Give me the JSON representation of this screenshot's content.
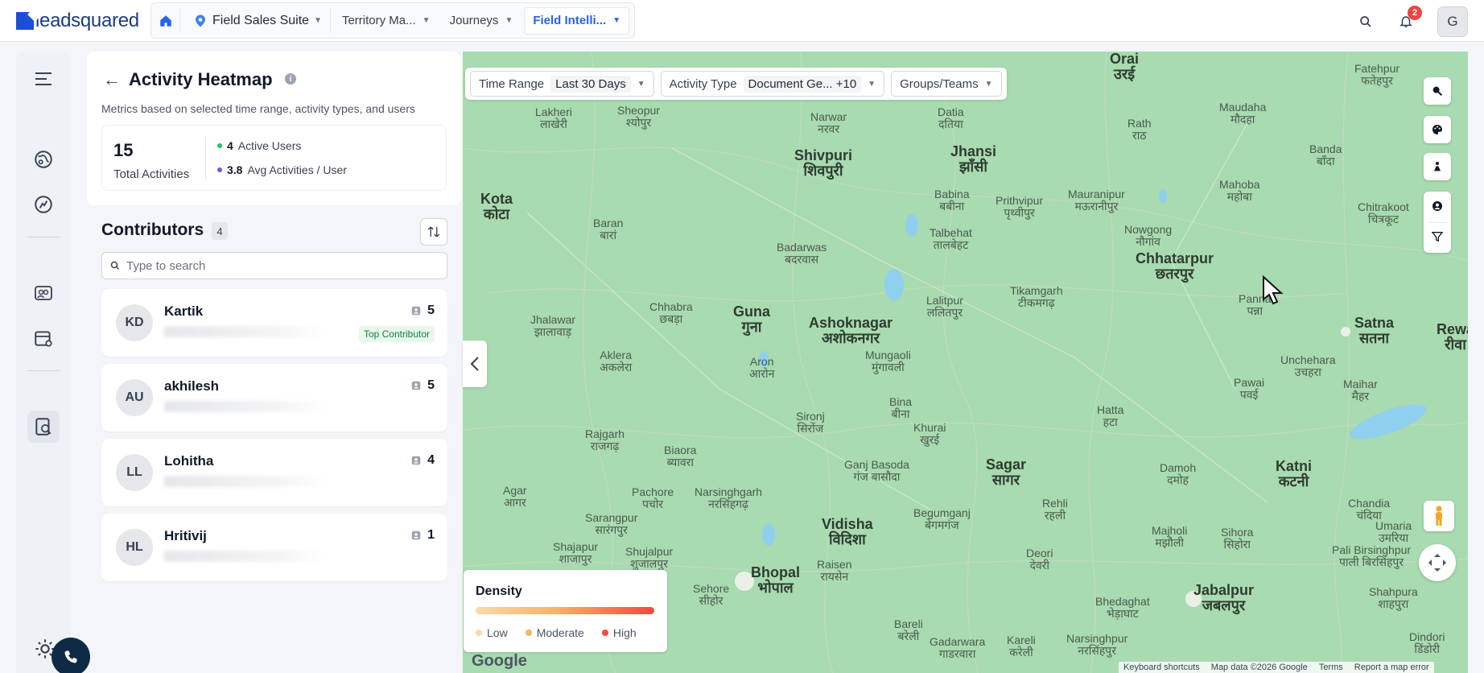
{
  "brand": {
    "name": "leadsquared"
  },
  "nav": {
    "suite": "Field Sales Suite",
    "tabs": [
      {
        "label": "Territory Ma..."
      },
      {
        "label": "Journeys"
      },
      {
        "label": "Field Intelli..."
      }
    ]
  },
  "header": {
    "notifications_count": "2",
    "user_initial": "G"
  },
  "panel": {
    "title": "Activity Heatmap",
    "subtitle": "Metrics based on selected time range, activity types, and users",
    "total_activities": "15",
    "total_activities_label": "Total Activities",
    "active_users_value": "4",
    "active_users_label": "Active Users",
    "avg_value": "3.8",
    "avg_label": "Avg Activities / User"
  },
  "contributors": {
    "title": "Contributors",
    "count": "4",
    "search_placeholder": "Type to search",
    "items": [
      {
        "initials": "KD",
        "name": "Kartik",
        "count": "5",
        "badge": "Top Contributor"
      },
      {
        "initials": "AU",
        "name": "akhilesh",
        "count": "5"
      },
      {
        "initials": "LL",
        "name": "Lohitha",
        "count": "4"
      },
      {
        "initials": "HL",
        "name": "Hritivij",
        "count": "1"
      }
    ]
  },
  "filters": {
    "time_range_label": "Time Range",
    "time_range_value": "Last 30 Days",
    "activity_type_label": "Activity Type",
    "activity_type_value": "Document Ge... +10",
    "groups_label": "Groups/Teams"
  },
  "legend": {
    "title": "Density",
    "low": "Low",
    "moderate": "Moderate",
    "high": "High",
    "colors": {
      "low": "#fcd9a8",
      "moderate": "#f7b264",
      "high": "#ef4b3c"
    }
  },
  "map": {
    "cities": [
      {
        "name": "Shivpuri",
        "native": "शिवपुरी",
        "size": "big"
      },
      {
        "name": "Jhansi",
        "native": "झाँसी",
        "size": "big"
      },
      {
        "name": "Kota",
        "native": "कोटा",
        "size": "big"
      },
      {
        "name": "Chhatarpur",
        "native": "छतरपुर",
        "size": "big"
      },
      {
        "name": "Guna",
        "native": "गुना",
        "size": "big"
      },
      {
        "name": "Ashoknagar",
        "native": "अशोकनगर",
        "size": "big"
      },
      {
        "name": "Satna",
        "native": "सतना",
        "size": "big"
      },
      {
        "name": "Rewa",
        "native": "रीवा",
        "size": "big"
      },
      {
        "name": "Sagar",
        "native": "सागर",
        "size": "big"
      },
      {
        "name": "Katni",
        "native": "कटनी",
        "size": "big"
      },
      {
        "name": "Vidisha",
        "native": "विदिशा",
        "size": "big"
      },
      {
        "name": "Bhopal",
        "native": "भोपाल",
        "size": "big"
      },
      {
        "name": "Jabalpur",
        "native": "जबलपुर",
        "size": "big"
      },
      {
        "name": "Lakheri",
        "native": "लाखेरी"
      },
      {
        "name": "Sheopur",
        "native": "श्योपुर"
      },
      {
        "name": "Narwar",
        "native": "नरवर"
      },
      {
        "name": "Datia",
        "native": "दतिया"
      },
      {
        "name": "Rath",
        "native": "राठ"
      },
      {
        "name": "Maudaha",
        "native": "मौदहा"
      },
      {
        "name": "Banda",
        "native": "बाँदा"
      },
      {
        "name": "Fatehpur",
        "native": "फतेहपुर"
      },
      {
        "name": "Baran",
        "native": "बारां"
      },
      {
        "name": "Babina",
        "native": "बबीना"
      },
      {
        "name": "Prithvipur",
        "native": "पृथ्वीपुर"
      },
      {
        "name": "Mauranipur",
        "native": "मऊरानीपुर"
      },
      {
        "name": "Mahoba",
        "native": "महोबा"
      },
      {
        "name": "Chitrakoot",
        "native": "चित्रकूट"
      },
      {
        "name": "Talbehat",
        "native": "तालबेहट"
      },
      {
        "name": "Nowgong",
        "native": "नौगांव"
      },
      {
        "name": "Badarwas",
        "native": "बदरवास"
      },
      {
        "name": "Tikamgarh",
        "native": "टीकमगढ़"
      },
      {
        "name": "Lalitpur",
        "native": "ललितपुर"
      },
      {
        "name": "Chhabra",
        "native": "छबड़ा"
      },
      {
        "name": "Jhalawar",
        "native": "झालावाड़"
      },
      {
        "name": "Aklera",
        "native": "अकलेरा"
      },
      {
        "name": "Aron",
        "native": "आरोन"
      },
      {
        "name": "Mungaoli",
        "native": "मुंगावली"
      },
      {
        "name": "Unchehara",
        "native": "उचहरा"
      },
      {
        "name": "Maihar",
        "native": "मैहर"
      },
      {
        "name": "Pawai",
        "native": "पवई"
      },
      {
        "name": "Bina",
        "native": "बीना"
      },
      {
        "name": "Sironj",
        "native": "सिरोंज"
      },
      {
        "name": "Khurai",
        "native": "खुरई"
      },
      {
        "name": "Hatta",
        "native": "हटा"
      },
      {
        "name": "Rajgarh",
        "native": "राजगढ़"
      },
      {
        "name": "Biaora",
        "native": "ब्यावरा"
      },
      {
        "name": "Ganj Basoda",
        "native": "गंज बासौदा"
      },
      {
        "name": "Damoh",
        "native": "दमोह"
      },
      {
        "name": "Agar",
        "native": "आगर"
      },
      {
        "name": "Pachore",
        "native": "पचोर"
      },
      {
        "name": "Narsinghgarh",
        "native": "नरसिंहगढ़"
      },
      {
        "name": "Rehli",
        "native": "रहली"
      },
      {
        "name": "Chandia",
        "native": "चंदिया"
      },
      {
        "name": "Sarangpur",
        "native": "सारंगपुर"
      },
      {
        "name": "Begumganj",
        "native": "बेगमगंज"
      },
      {
        "name": "Majholi",
        "native": "मझौली"
      },
      {
        "name": "Sihora",
        "native": "सिहोरा"
      },
      {
        "name": "Umaria",
        "native": "उमरिया"
      },
      {
        "name": "Shajapur",
        "native": "शाजापुर"
      },
      {
        "name": "Shujalpur",
        "native": "शुजालपुर"
      },
      {
        "name": "Raisen",
        "native": "रायसेन"
      },
      {
        "name": "Deori",
        "native": "देवरी"
      },
      {
        "name": "Pali Birsinghpur",
        "native": "पाली बिरसिंहपुर"
      },
      {
        "name": "Sehore",
        "native": "सीहोर"
      },
      {
        "name": "Bhedaghat",
        "native": "भेड़ाघाट"
      },
      {
        "name": "Shahpura",
        "native": "शाहपुरा"
      },
      {
        "name": "Bareli",
        "native": "बरेली"
      },
      {
        "name": "Gadarwara",
        "native": "गाडरवारा"
      },
      {
        "name": "Kareli",
        "native": "करेली"
      },
      {
        "name": "Narsinghpur",
        "native": "नरसिंहपुर"
      },
      {
        "name": "Dindori",
        "native": "डिंडोरी"
      },
      {
        "name": "Panna",
        "native": "पन्ना"
      },
      {
        "name": "Orai",
        "native": "उरई"
      }
    ],
    "attribution": {
      "shortcuts": "Keyboard shortcuts",
      "data": "Map data ©2026 Google",
      "terms": "Terms",
      "report": "Report a map error"
    },
    "google": "Google"
  }
}
